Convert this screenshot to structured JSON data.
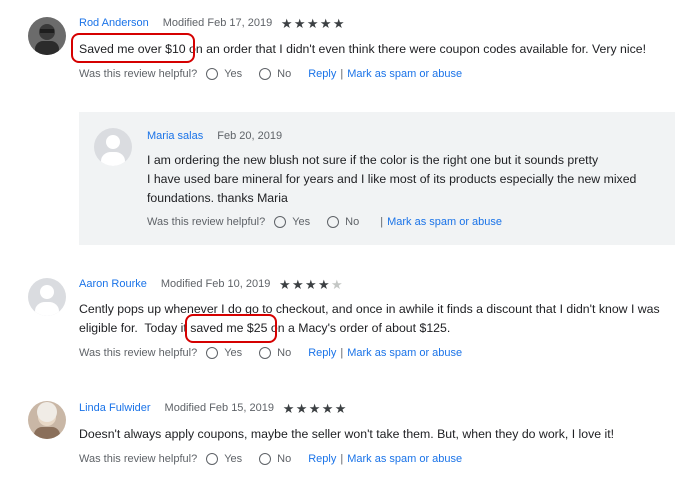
{
  "reviews": [
    {
      "name": "Rod Anderson",
      "date": "Modified Feb 17, 2019",
      "stars": 5,
      "text": [
        "Saved me over $10 on an order that I didn't even think there were coupon codes available for. Very nice!"
      ],
      "helpful": "Was this review helpful?",
      "yes": "Yes",
      "no": "No",
      "reply": "Reply",
      "spam": "Mark as spam or abuse"
    },
    {
      "name": "Maria salas",
      "date": "Feb 20, 2019",
      "text": [
        "I am ordering the new blush not sure if the color is the right one but it sounds pretty",
        "I have used bare mineral for years and I like most of its products especially the new mixed",
        "foundations. thanks Maria"
      ],
      "helpful": "Was this review helpful?",
      "yes": "Yes",
      "no": "No",
      "spam": "Mark as spam or abuse"
    },
    {
      "name": "Aaron Rourke",
      "date": "Modified Feb 10, 2019",
      "stars": 4,
      "text": [
        "Cently pops up whenever I do go to checkout, and once in awhile it finds a discount that I didn't know I was",
        "eligible for.  Today it saved me $25 on a Macy's order of about $125."
      ],
      "helpful": "Was this review helpful?",
      "yes": "Yes",
      "no": "No",
      "reply": "Reply",
      "spam": "Mark as spam or abuse"
    },
    {
      "name": "Linda Fulwider",
      "date": "Modified Feb 15, 2019",
      "stars": 5,
      "text": [
        "Doesn't always apply coupons, maybe the seller won't take them. But, when they do work, I love it!"
      ],
      "helpful": "Was this review helpful?",
      "yes": "Yes",
      "no": "No",
      "reply": "Reply",
      "spam": "Mark as spam or abuse"
    }
  ],
  "star_glyph": "★",
  "separator": "|",
  "colors": {
    "link": "#1a73e8",
    "highlight": "#d50000",
    "reply_bg": "#f1f3f4"
  }
}
